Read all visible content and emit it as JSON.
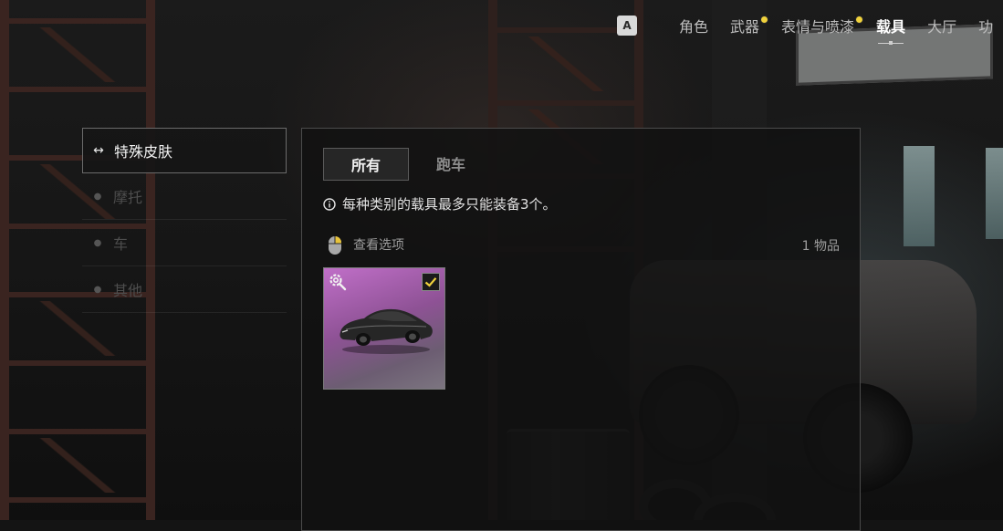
{
  "top_nav": {
    "key_hint": "A",
    "tabs": [
      {
        "label": "角色",
        "active": false,
        "notification": false
      },
      {
        "label": "武器",
        "active": false,
        "notification": true
      },
      {
        "label": "表情与喷漆",
        "active": false,
        "notification": true
      },
      {
        "label": "载具",
        "active": true,
        "notification": false
      },
      {
        "label": "大厅",
        "active": false,
        "notification": false
      },
      {
        "label": "功",
        "active": false,
        "notification": false
      }
    ]
  },
  "sidebar": {
    "items": [
      {
        "label": "特殊皮肤",
        "active": true,
        "icon": "double-arrow-icon"
      },
      {
        "label": "摩托",
        "active": false,
        "icon": "bullet-icon"
      },
      {
        "label": "车",
        "active": false,
        "icon": "bullet-icon"
      },
      {
        "label": "其他",
        "active": false,
        "icon": "bullet-icon"
      }
    ]
  },
  "main": {
    "tabs": [
      {
        "label": "所有",
        "active": true
      },
      {
        "label": "跑车",
        "active": false
      }
    ],
    "notice": "每种类别的载具最多只能装备3个。",
    "view_options": "查看选项",
    "item_count": "1 物品",
    "items": [
      {
        "name": "sports-car-skin",
        "equipped": true,
        "rarity_color": "#b46cbd"
      }
    ]
  },
  "colors": {
    "notification_dot": "#f0d23c",
    "check": "#f0d23c"
  }
}
